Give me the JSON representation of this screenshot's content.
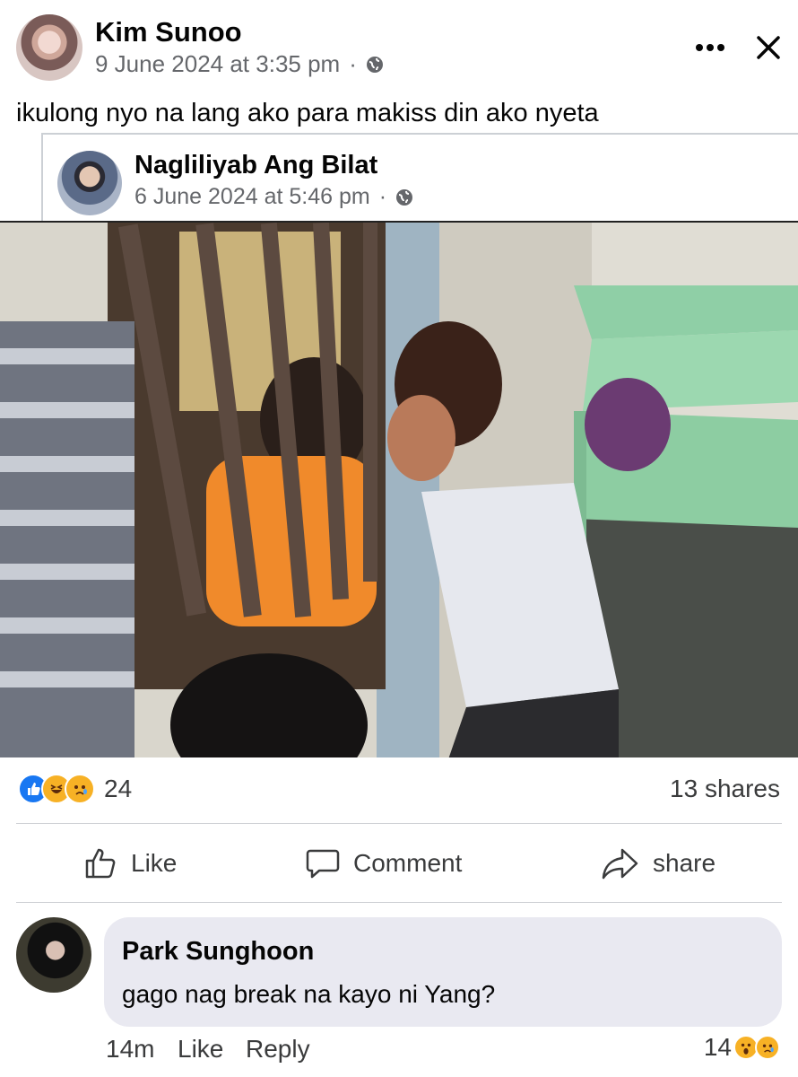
{
  "post": {
    "author": "Kim Sunoo",
    "timestamp": "9 June 2024 at 3:35 pm",
    "separator": "·",
    "privacy_icon": "globe-icon",
    "caption": "ikulong nyo na lang ako para makiss din ako nyeta",
    "more_icon": "more-options-icon",
    "close_icon": "close-icon"
  },
  "shared_post": {
    "author": "Nagliliyab Ang Bilat",
    "timestamp": "6 June 2024 at 5:46 pm",
    "separator": "·",
    "privacy_icon": "globe-icon"
  },
  "engagement": {
    "reaction_icons": [
      "like-reaction-icon",
      "haha-reaction-icon",
      "sad-reaction-icon"
    ],
    "reaction_count": "24",
    "shares": "13 shares"
  },
  "actions": {
    "like": "Like",
    "comment": "Comment",
    "share": "share"
  },
  "comment": {
    "author": "Park Sunghoon",
    "text": "gago nag break na kayo ni Yang?",
    "time": "14m",
    "like": "Like",
    "reply": "Reply",
    "reaction_count": "14",
    "reaction_icons": [
      "wow-reaction-icon",
      "sad-reaction-icon"
    ]
  },
  "colors": {
    "accent": "#1877f2",
    "secondary_text": "#65676b",
    "bubble": "#e9e9f1"
  }
}
